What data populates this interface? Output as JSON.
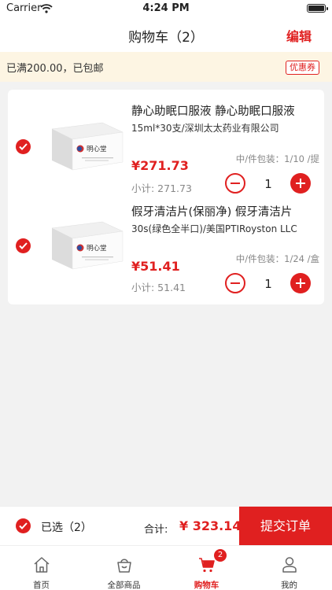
{
  "status_bar": {
    "carrier": "Carrier",
    "time": "4:24 PM"
  },
  "nav": {
    "title": "购物车（2）",
    "edit": "编辑"
  },
  "notice": {
    "text": "已满200.00，已包邮",
    "coupon": "优惠券"
  },
  "items": [
    {
      "name": "静心助眠口服液 静心助眠口服液",
      "spec": "15ml*30支/深圳太太药业有限公司",
      "price": "¥271.73",
      "subtotal": "小计: 271.73",
      "pack": "中/件包装：1/10 /提",
      "quantity": "1",
      "brand": "明心堂",
      "checked": true
    },
    {
      "name": "假牙清洁片(保丽净) 假牙清洁片",
      "spec": "30s(绿色全半口)/美国PTIRoyston LLC",
      "price": "¥51.41",
      "subtotal": "小计: 51.41",
      "pack": "中/件包装：1/24 /盒",
      "quantity": "1",
      "brand": "明心堂",
      "checked": true
    }
  ],
  "bottom": {
    "selected": "已选（2）",
    "total_label": "合计:",
    "total_value": "¥ 323.14",
    "submit": "提交订单"
  },
  "tabs": [
    {
      "label": "首页",
      "icon": "home-icon"
    },
    {
      "label": "全部商品",
      "icon": "bag-icon"
    },
    {
      "label": "购物车",
      "icon": "cart-icon",
      "badge": "2",
      "active": true
    },
    {
      "label": "我的",
      "icon": "user-icon"
    }
  ],
  "colors": {
    "accent": "#e02020",
    "notice_bg": "#fdf5e3",
    "page_bg": "#f2f2f2"
  }
}
